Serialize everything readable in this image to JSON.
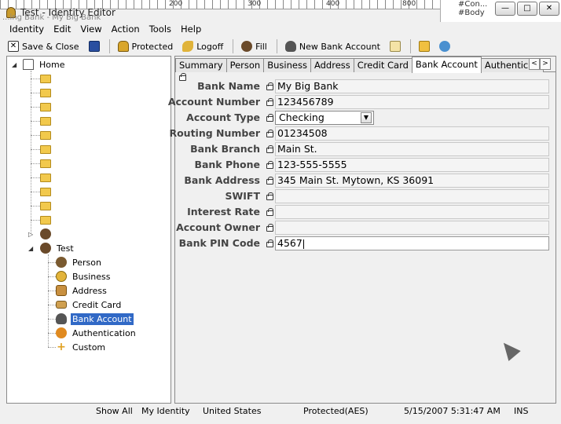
{
  "window": {
    "title": "Test - Identity Editor",
    "background_caption": "...ing Bank - My Big Bank",
    "background_right_lines": [
      "#Con...",
      "#Body"
    ],
    "minimize": "—",
    "maximize": "□",
    "close": "✕"
  },
  "menu": [
    "Identity",
    "Edit",
    "View",
    "Action",
    "Tools",
    "Help"
  ],
  "toolbar": {
    "save_close": "Save & Close",
    "protected": "Protected",
    "logoff": "Logoff",
    "fill": "Fill",
    "new_bank_account": "New Bank Account"
  },
  "tree": {
    "home": "Home",
    "test": "Test",
    "children": [
      "Person",
      "Business",
      "Address",
      "Credit Card",
      "Bank Account",
      "Authentication",
      "Custom"
    ],
    "selected": "Bank Account"
  },
  "tabs": [
    "Summary",
    "Person",
    "Business",
    "Address",
    "Credit Card",
    "Bank Account",
    "Authentication"
  ],
  "active_tab": "Bank Account",
  "tab_nav": {
    "prev": "<",
    "next": ">"
  },
  "form": {
    "bank_name": {
      "label": "Bank Name",
      "value": "My Big Bank"
    },
    "account_number": {
      "label": "Account Number",
      "value": "123456789"
    },
    "account_type": {
      "label": "Account Type",
      "value": "Checking"
    },
    "routing_number": {
      "label": "Routing Number",
      "value": "01234508"
    },
    "bank_branch": {
      "label": "Bank Branch",
      "value": "Main St."
    },
    "bank_phone": {
      "label": "Bank Phone",
      "value": "123-555-5555"
    },
    "bank_address": {
      "label": "Bank Address",
      "value": "345 Main St. Mytown, KS 36091"
    },
    "swift": {
      "label": "SWIFT",
      "value": ""
    },
    "interest_rate": {
      "label": "Interest Rate",
      "value": ""
    },
    "account_owner": {
      "label": "Account Owner",
      "value": ""
    },
    "bank_pin_code": {
      "label": "Bank PIN Code",
      "value": "4567"
    }
  },
  "status": {
    "show_all": "Show All",
    "identity": "My Identity",
    "country": "United States",
    "protection": "Protected(AES)",
    "datetime": "5/15/2007 5:31:47 AM",
    "mode": "INS"
  },
  "colors": {
    "selection": "#3169c6",
    "folder": "#f2c94c"
  }
}
